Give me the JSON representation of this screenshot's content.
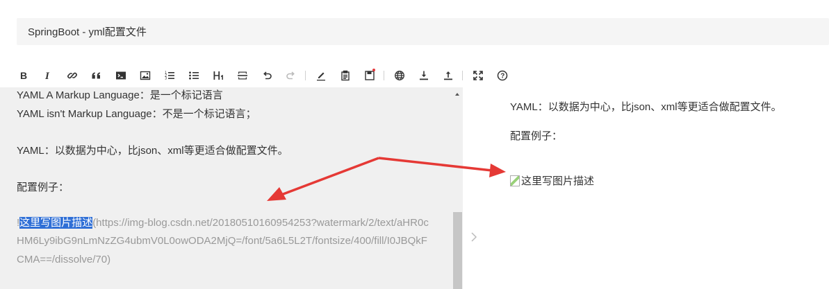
{
  "title": "SpringBoot - yml配置文件",
  "toolbar": {
    "items": [
      {
        "name": "bold-button",
        "icon": "bold-icon"
      },
      {
        "name": "italic-button",
        "icon": "italic-icon"
      },
      {
        "name": "link-button",
        "icon": "link-icon"
      },
      {
        "name": "quote-button",
        "icon": "quote-icon"
      },
      {
        "name": "code-button",
        "icon": "code-icon"
      },
      {
        "name": "image-button",
        "icon": "image-icon"
      },
      {
        "name": "ordered-list-button",
        "icon": "ordered-list-icon"
      },
      {
        "name": "unordered-list-button",
        "icon": "unordered-list-icon"
      },
      {
        "name": "heading-button",
        "icon": "heading-icon"
      },
      {
        "name": "horizontal-rule-button",
        "icon": "horizontal-rule-icon"
      },
      {
        "name": "undo-button",
        "icon": "undo-icon"
      },
      {
        "name": "redo-button",
        "icon": "redo-icon"
      },
      {
        "name": "clean-button",
        "icon": "pen-icon"
      },
      {
        "name": "template-button",
        "icon": "clipboard-icon"
      },
      {
        "name": "draft-button",
        "icon": "save-icon"
      },
      {
        "name": "publish-button",
        "icon": "globe-icon"
      },
      {
        "name": "import-button",
        "icon": "import-icon"
      },
      {
        "name": "export-button",
        "icon": "export-icon"
      },
      {
        "name": "fullscreen-button",
        "icon": "fullscreen-icon"
      },
      {
        "name": "help-button",
        "icon": "help-icon"
      }
    ]
  },
  "editor": {
    "lines": [
      "YAML A Markup Language：是一个标记语言",
      "YAML isn't Markup Language：不是一个标记语言；",
      "",
      "YAML：以数据为中心，比json、xml等更适合做配置文件。",
      "",
      "配置例子：",
      ""
    ],
    "image_markdown": {
      "bang": "!",
      "selected_alt": "这里写图片描述",
      "url_text": "(https://img-blog.csdn.net/20180510160954253?watermark/2/text/aHR0cHM6Ly9ibG9nLmNzZG4ubmV0L0owODA2MjQ=/font/5a6L5L2T/fontsize/400/fill/I0JBQkFCMA==/dissolve/70)"
    }
  },
  "preview": {
    "paragraph1": "YAML：以数据为中心，比json、xml等更适合做配置文件。",
    "paragraph2": "配置例子：",
    "image_alt": "这里写图片描述"
  },
  "colors": {
    "selection": "#2f6fd6",
    "annotation_arrow": "#e53935",
    "editor_bg": "#f0f0f0"
  }
}
